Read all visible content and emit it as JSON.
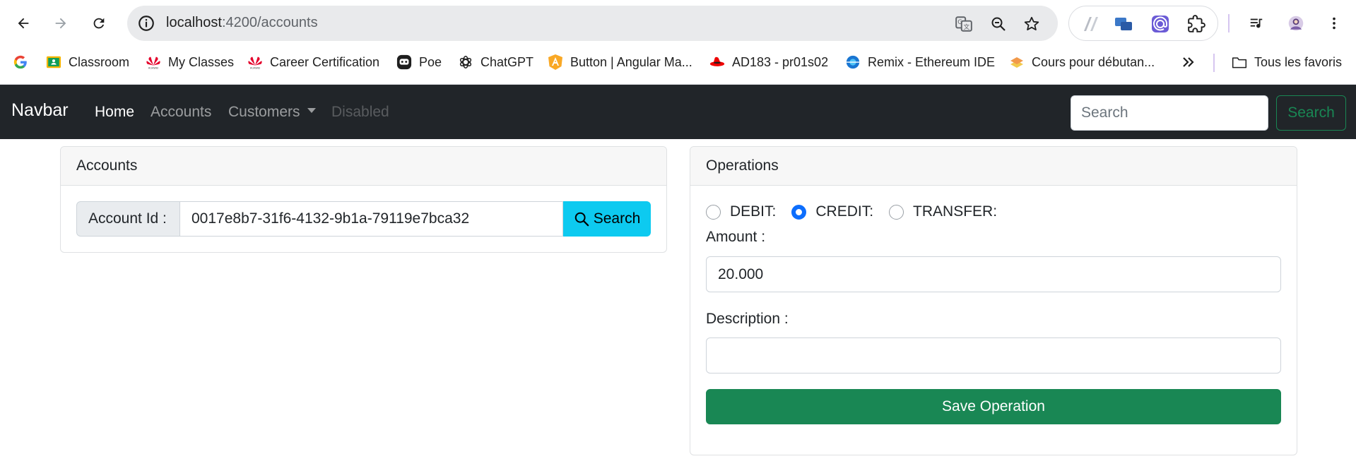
{
  "browser": {
    "url_host": "localhost",
    "url_path": ":4200/accounts",
    "bookmarks": [
      {
        "label": "Classroom",
        "icon": "google-classroom-icon",
        "color": "#f4b400"
      },
      {
        "label": "My Classes",
        "icon": "huawei-icon",
        "color": "#e4002b"
      },
      {
        "label": "Career Certification",
        "icon": "huawei-icon",
        "color": "#e4002b"
      },
      {
        "label": "Poe",
        "icon": "poe-icon",
        "color": "#1f1f1f"
      },
      {
        "label": "ChatGPT",
        "icon": "chatgpt-icon",
        "color": "#1f1f1f"
      },
      {
        "label": "Button | Angular Ma...",
        "icon": "angular-material-icon",
        "color": "#f9a825"
      },
      {
        "label": "AD183 - pr01s02",
        "icon": "redhat-icon",
        "color": "#ee0000"
      },
      {
        "label": "Remix - Ethereum IDE",
        "icon": "remix-icon",
        "color": "#1976d2"
      },
      {
        "label": "Cours pour débutan...",
        "icon": "course-icon",
        "color": "#f2c94c"
      }
    ],
    "all_bookmarks_label": "Tous les favoris"
  },
  "navbar": {
    "brand": "Navbar",
    "links": {
      "home": "Home",
      "accounts": "Accounts",
      "customers": "Customers",
      "disabled": "Disabled"
    },
    "search_placeholder": "Search",
    "search_button": "Search"
  },
  "accounts_card": {
    "title": "Accounts",
    "account_id_label": "Account Id :",
    "account_id_value": "0017e8b7-31f6-4132-9b1a-79119e7bca32",
    "search_button": "Search"
  },
  "operations_card": {
    "title": "Operations",
    "operation_types": [
      {
        "label": "DEBIT:",
        "checked": false
      },
      {
        "label": "CREDIT:",
        "checked": true
      },
      {
        "label": "TRANSFER:",
        "checked": false
      }
    ],
    "amount_label": "Amount :",
    "amount_value": "20.000",
    "description_label": "Description :",
    "description_value": "",
    "save_button": "Save Operation"
  },
  "colors": {
    "navbar_bg": "#212529",
    "primary": "#0d6efd",
    "success": "#198754",
    "info": "#0dcaf0"
  }
}
